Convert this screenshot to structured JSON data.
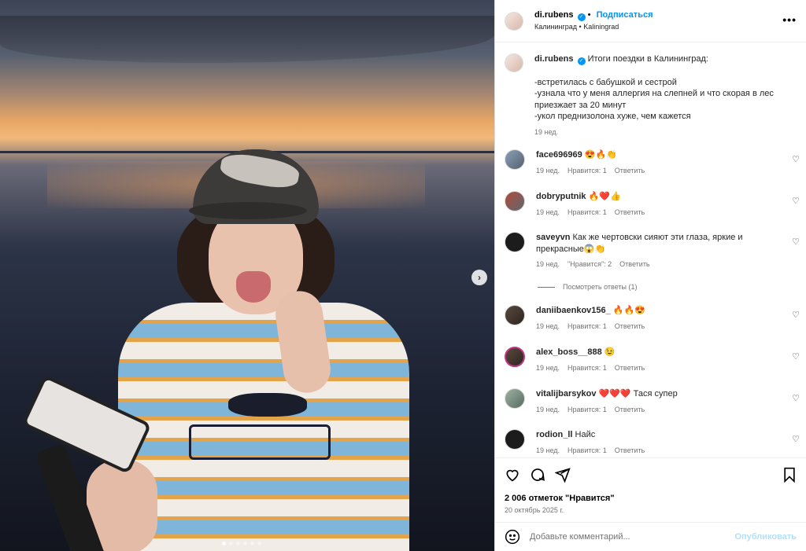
{
  "post": {
    "username": "di.rubens",
    "verified_mark": "✓",
    "follow_label": "Подписаться",
    "separator": "•",
    "location": "Калининград • Kaliningrad",
    "more_icon": "more-horizontal-icon"
  },
  "caption": {
    "username": "di.rubens",
    "lines": [
      "Итоги поездки в Калининград:",
      "",
      "-встретилась с бабушкой и сестрой",
      "-узнала что у меня аллергия на слепней и что скорая в лес приезжает за 20 минут",
      "-укол преднизолона хуже, чем кажется"
    ],
    "time": "19 нед."
  },
  "comments": [
    {
      "user": "face696969",
      "text": "😍🔥👏",
      "time": "19 нед.",
      "likes": "Нравится: 1",
      "reply": "Ответить"
    },
    {
      "user": "dobryputnik",
      "text": "🔥❤️👍",
      "time": "19 нед.",
      "likes": "Нравится: 1",
      "reply": "Ответить"
    },
    {
      "user": "saveyvn",
      "text": "Как же чертовски сияют эти глаза, яркие и прекрасные😱👏",
      "time": "19 нед.",
      "likes": "\"Нравится\": 2",
      "reply": "Ответить"
    },
    {
      "user": "daniibaenkov156_",
      "text": "🔥🔥😍",
      "time": "19 нед.",
      "likes": "Нравится: 1",
      "reply": "Ответить"
    },
    {
      "user": "alex_boss__888",
      "text": "😉",
      "time": "19 нед.",
      "likes": "Нравится: 1",
      "reply": "Ответить"
    },
    {
      "user": "vitalijbarsykov",
      "text": "❤️❤️❤️ Тася супер",
      "time": "19 нед.",
      "likes": "Нравится: 1",
      "reply": "Ответить"
    },
    {
      "user": "rodion_ll",
      "text": "Найс",
      "time": "19 нед.",
      "likes": "Нравится: 1",
      "reply": "Ответить"
    }
  ],
  "view_replies": "Посмотреть ответы (1)",
  "footer": {
    "likes": "2 006 отметок \"Нравится\"",
    "date": "20 октябрь 2025 г.",
    "comment_placeholder": "Добавьте комментарий...",
    "publish_label": "Опубликовать"
  },
  "carousel": {
    "slide_count": 6,
    "active_slide": 1,
    "next_icon": "chevron-right-icon"
  },
  "colors": {
    "accent": "#0095f6",
    "publish_disabled": "#b2dffc",
    "muted": "#737373"
  }
}
